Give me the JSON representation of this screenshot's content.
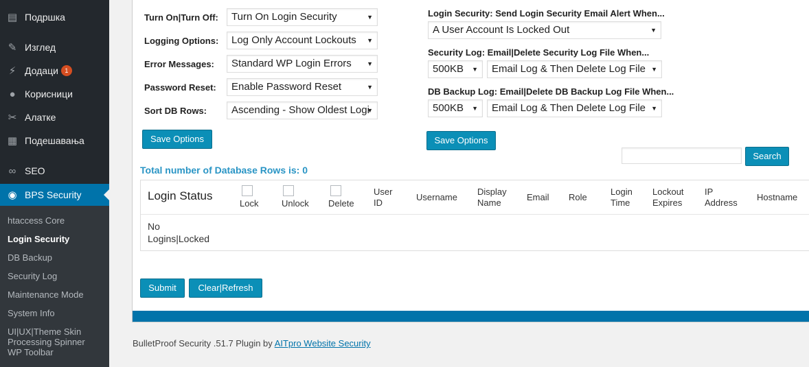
{
  "sidebar": {
    "items": [
      {
        "label": "Подршка",
        "icon": "dashboard-icon"
      },
      {
        "label": "Изглед",
        "icon": "paintbrush-icon"
      },
      {
        "label": "Додаци",
        "icon": "plugin-icon",
        "badge": "1"
      },
      {
        "label": "Корисници",
        "icon": "users-icon"
      },
      {
        "label": "Алатке",
        "icon": "wrench-icon"
      },
      {
        "label": "Подешавања",
        "icon": "settings-icon"
      },
      {
        "label": "SEO",
        "icon": "seo-icon"
      },
      {
        "label": "BPS Security",
        "icon": "bps-shield-icon"
      }
    ],
    "submenu": [
      "htaccess Core",
      "Login Security",
      "DB Backup",
      "Security Log",
      "Maintenance Mode",
      "System Info",
      "UI|UX|Theme Skin",
      "Processing Spinner",
      "WP Toolbar"
    ]
  },
  "options": {
    "turn_on_label": "Turn On|Turn Off:",
    "turn_on_value": "Turn On Login Security",
    "logging_label": "Logging Options:",
    "logging_value": "Log Only Account Lockouts",
    "errors_label": "Error Messages:",
    "errors_value": "Standard WP Login Errors",
    "password_label": "Password Reset:",
    "password_value": "Enable Password Reset",
    "sort_label": "Sort DB Rows:",
    "sort_value": "Ascending - Show Oldest Logi",
    "save_label": "Save Options"
  },
  "alerts": {
    "email_label": "Login Security: Send Login Security Email Alert When...",
    "email_value": "A User Account Is Locked Out",
    "seclog_label": "Security Log: Email|Delete Security Log File When...",
    "seclog_size": "500KB",
    "seclog_action": "Email Log & Then Delete Log File",
    "dblog_label": "DB Backup Log: Email|Delete DB Backup Log File When...",
    "dblog_size": "500KB",
    "dblog_action": "Email Log & Then Delete Log File",
    "save_label": "Save Options"
  },
  "search": {
    "placeholder": "",
    "button_label": "Search"
  },
  "table": {
    "total_rows_text": "Total number of Database Rows is: 0",
    "title": "Login Status",
    "col_lock": "Lock",
    "col_unlock": "Unlock",
    "col_delete": "Delete",
    "col_user_id_1": "User",
    "col_user_id_2": "ID",
    "col_username": "Username",
    "col_display_1": "Display",
    "col_display_2": "Name",
    "col_email": "Email",
    "col_role": "Role",
    "col_login_1": "Login",
    "col_login_2": "Time",
    "col_lockout_1": "Lockout",
    "col_lockout_2": "Expires",
    "col_ip_1": "IP",
    "col_ip_2": "Address",
    "col_hostname": "Hostname",
    "empty_1": "No",
    "empty_2": "Logins|Locked"
  },
  "actions": {
    "submit_label": "Submit",
    "refresh_label": "Clear|Refresh"
  },
  "footer": {
    "text": "BulletProof Security .51.7 Plugin by ",
    "link": "AITpro Website Security"
  },
  "colors": {
    "sidebar_bg": "#23282d",
    "submenu_bg": "#32373c",
    "accent": "#0073aa",
    "button": "#0b8fb7",
    "total_rows": "#2a95c5",
    "badge": "#d54e21"
  }
}
